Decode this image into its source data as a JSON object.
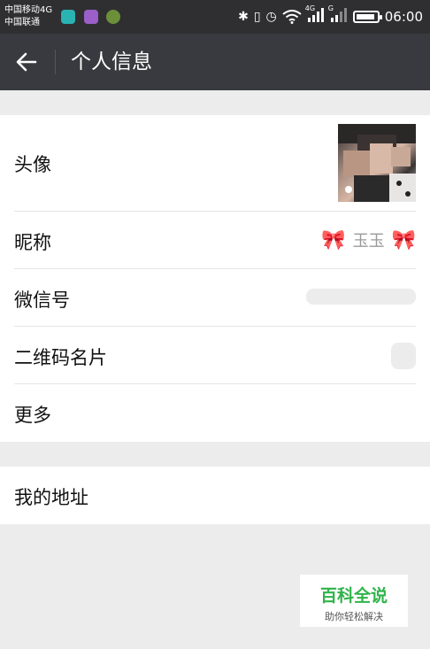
{
  "status_bar": {
    "carrier1": "中国移动4G",
    "carrier2": "中国联通",
    "net1": "4G",
    "net2": "G",
    "time": "06:00",
    "icons": [
      "bluetooth-icon",
      "vibrate-icon",
      "alarm-icon",
      "wifi-icon",
      "signal-icon",
      "signal-icon",
      "battery-icon"
    ]
  },
  "header": {
    "title": "个人信息"
  },
  "profile": {
    "avatar_label": "头像",
    "nickname_label": "昵称",
    "nickname_value": "玉玉",
    "nickname_bow": "🎀",
    "wechat_id_label": "微信号",
    "qrcode_label": "二维码名片",
    "more_label": "更多"
  },
  "address": {
    "label": "我的地址"
  },
  "watermark": {
    "main": "百科全说",
    "sub": "助你轻松解决"
  },
  "colors": {
    "status_bar": "#2f2f32",
    "app_bar": "#393a3f",
    "background": "#ececec",
    "watermark_green": "#2fb34a"
  }
}
